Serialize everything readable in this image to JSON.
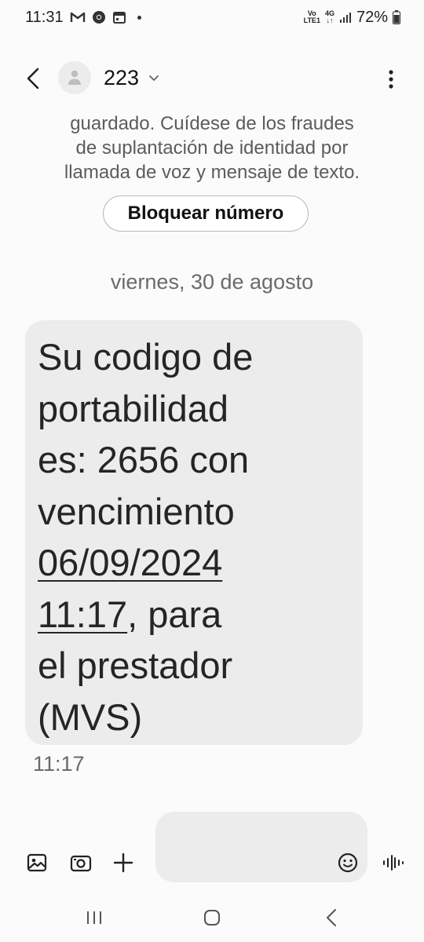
{
  "status_bar": {
    "time": "11:31",
    "volte_top": "Vo",
    "volte_bottom": "LTE1",
    "network": "4G",
    "battery": "72%"
  },
  "header": {
    "contact": "223"
  },
  "warning_lines": [
    "guardado. Cuídese de los fraudes",
    "de suplantación de identidad por",
    "llamada de voz y mensaje de texto."
  ],
  "block_button_label": "Bloquear número",
  "date_separator": "viernes, 30 de agosto",
  "message": {
    "line1": "Su codigo de",
    "line2": "portabilidad",
    "line3": "es: 2656 con",
    "line4": "vencimiento",
    "line5_link": "06/09/2024",
    "line6_link": "11:17",
    "line6_rest": ", para",
    "line7": "el prestador",
    "line8": "(MVS)",
    "time": "11:17"
  },
  "icons": {
    "status_left": [
      "gmail-icon",
      "chrome-icon",
      "calendar-icon"
    ],
    "composer": [
      "gallery-icon",
      "camera-icon",
      "plus-icon",
      "emoji-icon",
      "voice-icon"
    ],
    "nav": [
      "recents-icon",
      "home-icon",
      "back-nav-icon"
    ]
  }
}
